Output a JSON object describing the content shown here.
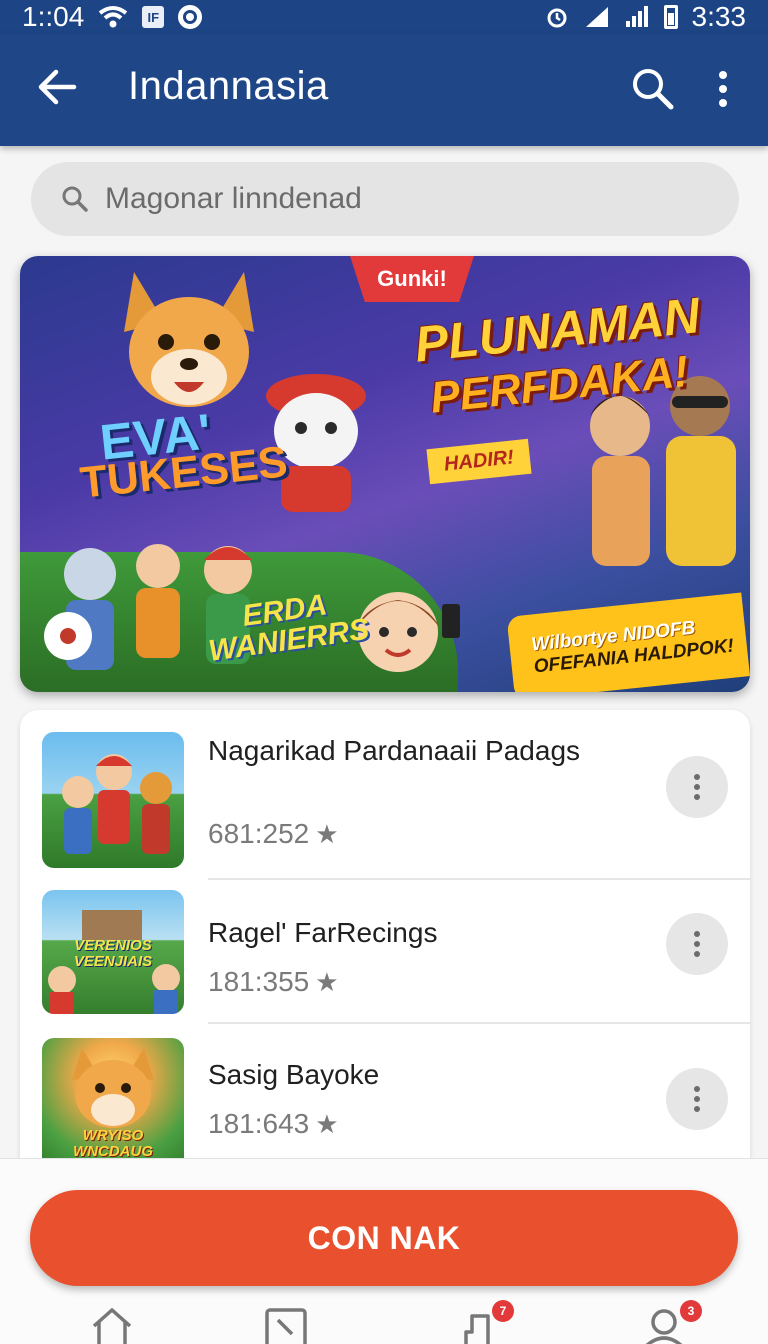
{
  "status_bar": {
    "time_left": "1::04",
    "badge": " ",
    "time_right": "3:33"
  },
  "app_bar": {
    "title": "Indannasia"
  },
  "search": {
    "placeholder": "Magonar linndenad"
  },
  "banner": {
    "ribbon": "Gunki!",
    "headline_1": "PLUNAMAN",
    "headline_2": "PERFDAKA!",
    "tag": "HADIR!",
    "left_title_1": "EVA'",
    "left_title_2": "TUKESES",
    "center_logo_1": "ERDA",
    "center_logo_2": "WANIERRS",
    "promo_1": "Wilbortye NIDOFB",
    "promo_2": "OFEFANIA HALDPOK!"
  },
  "list": {
    "items": [
      {
        "name": "Nagarikad Pardanaaii Padags",
        "rating": "681:252",
        "thumb_label": ""
      },
      {
        "name": "Ragel' FarRecings",
        "rating": "181:355",
        "thumb_label": "VERENIOS VEENJIAIS"
      },
      {
        "name": "Sasig Bayoke",
        "rating": "181:643",
        "thumb_label": "WRYISO WNCDAUG"
      }
    ]
  },
  "cta": {
    "label": "CON NAK"
  },
  "bottom_nav": {
    "badges": [
      "7",
      "3"
    ]
  },
  "colors": {
    "primary": "#1f4686",
    "accent": "#e8502e"
  }
}
